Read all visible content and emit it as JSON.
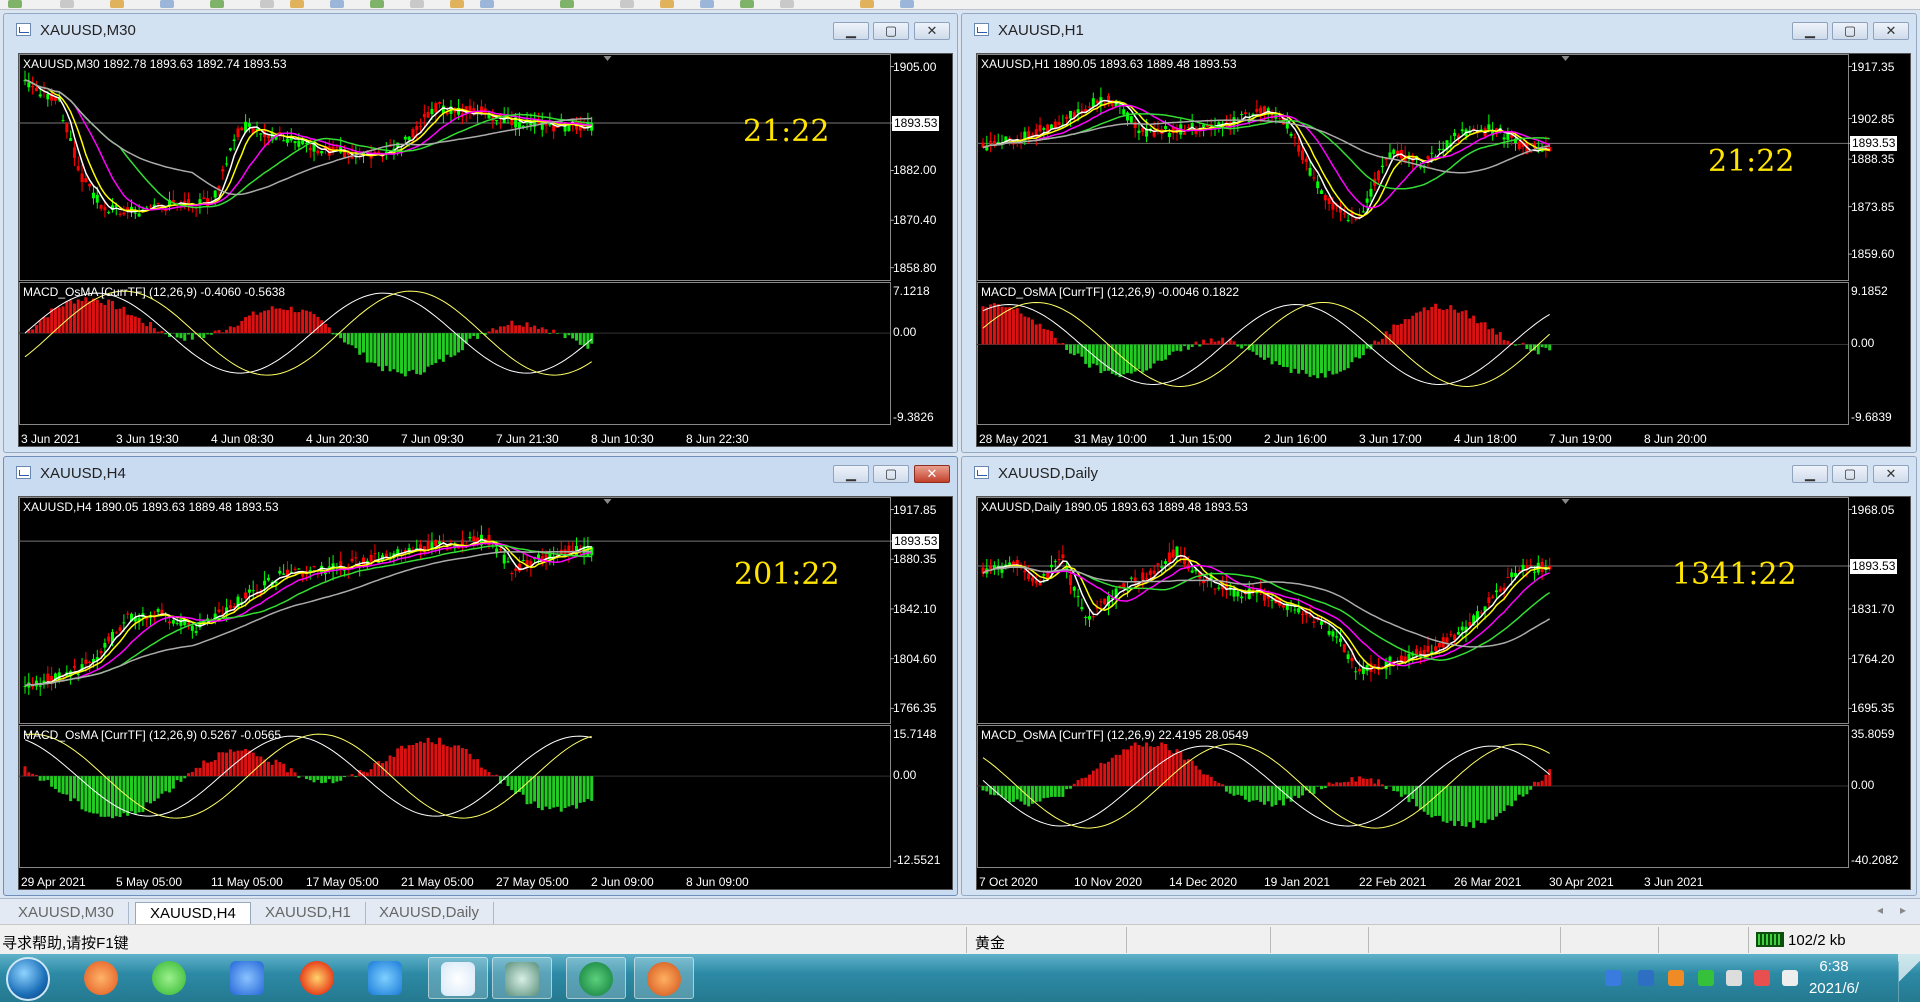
{
  "toolbar": {
    "label": "toolbar"
  },
  "windows": [
    {
      "id": "m30",
      "title": "XAUUSD,M30",
      "active": false,
      "header": "XAUUSD,M30  1892.78 1893.63 1892.74 1893.53",
      "clock": "21:22",
      "prices": [
        "1905.00",
        "1893.53",
        "1882.00",
        "1870.40",
        "1858.80"
      ],
      "current": "1893.53",
      "macd_label": "MACD_OsMA [CurrTF] (12,26,9) -0.4060 -0.5638",
      "macd_scale": [
        "7.1218",
        "0.00",
        "-9.3826"
      ],
      "dates": [
        "3 Jun 2021",
        "3 Jun 19:30",
        "4 Jun 08:30",
        "4 Jun 20:30",
        "7 Jun 09:30",
        "7 Jun 21:30",
        "8 Jun 10:30",
        "8 Jun 22:30"
      ]
    },
    {
      "id": "h1",
      "title": "XAUUSD,H1",
      "active": false,
      "header": "XAUUSD,H1  1890.05 1893.63 1889.48 1893.53",
      "clock": "21:22",
      "prices": [
        "1917.35",
        "1902.85",
        "1893.53",
        "1888.35",
        "1873.85",
        "1859.60"
      ],
      "current": "1893.53",
      "macd_label": "MACD_OsMA [CurrTF] (12,26,9) -0.0046 0.1822",
      "macd_scale": [
        "9.1852",
        "0.00",
        "-9.6839"
      ],
      "dates": [
        "28 May 2021",
        "31 May 10:00",
        "1 Jun 15:00",
        "2 Jun 16:00",
        "3 Jun 17:00",
        "4 Jun 18:00",
        "7 Jun 19:00",
        "8 Jun 20:00"
      ]
    },
    {
      "id": "h4",
      "title": "XAUUSD,H4",
      "active": true,
      "header": "XAUUSD,H4  1890.05 1893.63 1889.48 1893.53",
      "clock": "201:22",
      "prices": [
        "1917.85",
        "1893.53",
        "1880.35",
        "1842.10",
        "1804.60",
        "1766.35"
      ],
      "current": "1893.53",
      "macd_label": "MACD_OsMA [CurrTF] (12,26,9) 0.5267 -0.0565",
      "macd_scale": [
        "15.7148",
        "0.00",
        "-12.5521"
      ],
      "dates": [
        "29 Apr 2021",
        "5 May 05:00",
        "11 May 05:00",
        "17 May 05:00",
        "21 May 05:00",
        "27 May 05:00",
        "2 Jun 09:00",
        "8 Jun 09:00"
      ]
    },
    {
      "id": "d1",
      "title": "XAUUSD,Daily",
      "active": false,
      "header": "XAUUSD,Daily  1890.05 1893.63 1889.48 1893.53",
      "clock": "1341:22",
      "prices": [
        "1968.05",
        "1893.53",
        "1831.70",
        "1764.20",
        "1695.35"
      ],
      "current": "1893.53",
      "macd_label": "MACD_OsMA [CurrTF] (12,26,9) 22.4195 28.0549",
      "macd_scale": [
        "35.8059",
        "0.00",
        "-40.2082"
      ],
      "dates": [
        "7 Oct 2020",
        "10 Nov 2020",
        "14 Dec 2020",
        "19 Jan 2021",
        "22 Feb 2021",
        "26 Mar 2021",
        "30 Apr 2021",
        "3 Jun 2021"
      ]
    }
  ],
  "tabs": [
    "XAUUSD,M30",
    "XAUUSD,H4",
    "XAUUSD,H1",
    "XAUUSD,Daily"
  ],
  "active_tab": "XAUUSD,H4",
  "status": {
    "help": "寻求帮助,请按F1键",
    "profile": "黄金",
    "traffic": "102/2 kb"
  },
  "taskbar": {
    "time": "6:38",
    "date": "2021/6/"
  },
  "colors": {
    "bull": "#00ff00",
    "bear": "#ff0000",
    "macd_up": "#dd1111",
    "macd_down": "#22cc22",
    "ma_white": "#ffffff",
    "ma_yellow": "#ffff00",
    "ma_magenta": "#ff00ff",
    "ma_green": "#33dd33",
    "ma_gray": "#aaaaaa",
    "clock": "#ffe400"
  },
  "taskbar_icons": [
    "firefox-like-browser-icon",
    "wechat-icon",
    "feishu-icon",
    "firefox-icon",
    "lark-icon",
    "tradingview-icon",
    "metatrader-icon",
    "green-circle-icon",
    "mascot-icon"
  ]
}
